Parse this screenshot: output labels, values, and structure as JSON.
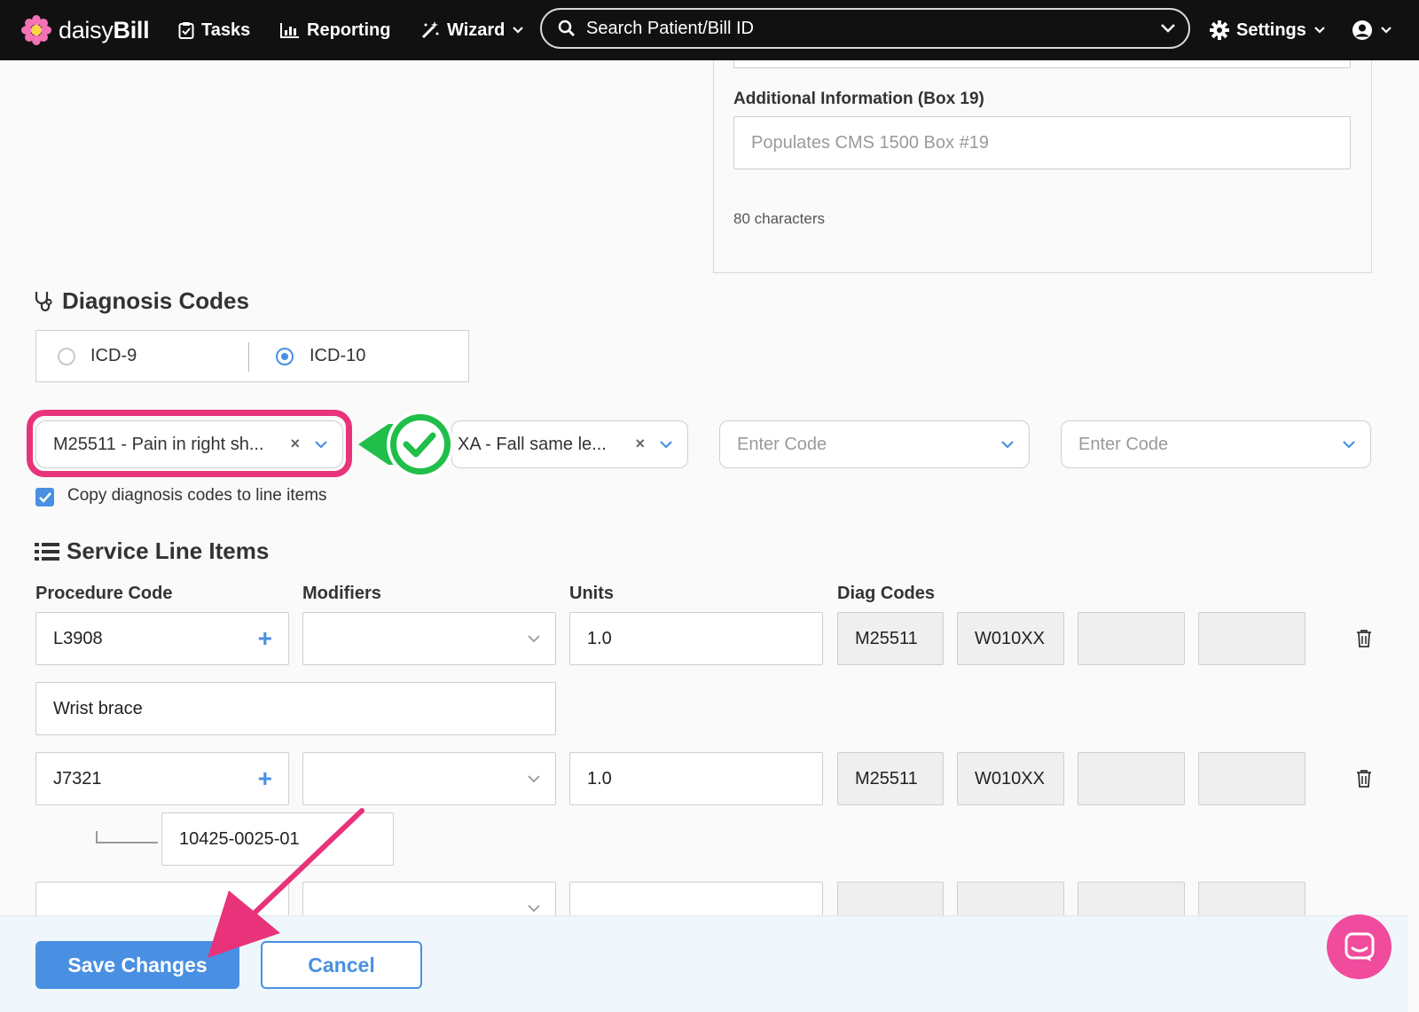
{
  "nav": {
    "logo_text_light": "daisy",
    "logo_text_bold": "Bill",
    "tasks_label": "Tasks",
    "reporting_label": "Reporting",
    "wizard_label": "Wizard",
    "search_placeholder": "Search Patient/Bill ID",
    "settings_label": "Settings"
  },
  "additional_info": {
    "label": "Additional Information (Box 19)",
    "placeholder": "Populates CMS 1500 Box #19",
    "char_count": "80 characters"
  },
  "diagnosis": {
    "title": "Diagnosis Codes",
    "icd9_label": "ICD-9",
    "icd10_label": "ICD-10",
    "selected_standard": "ICD-10",
    "code1": "M25511 - Pain in right sh...",
    "code2": "XA - Fall same le...",
    "code3_placeholder": "Enter Code",
    "code4_placeholder": "Enter Code",
    "copy_label": "Copy diagnosis codes to line items",
    "copy_checked": true
  },
  "service_lines": {
    "title": "Service Line Items",
    "headers": {
      "procedure": "Procedure Code",
      "modifiers": "Modifiers",
      "units": "Units",
      "diag": "Diag Codes"
    },
    "rows": [
      {
        "procedure": "L3908",
        "units": "1.0",
        "diag1": "M25511",
        "diag2": "W010XX",
        "description": "Wrist brace"
      },
      {
        "procedure": "J7321",
        "units": "1.0",
        "diag1": "M25511",
        "diag2": "W010XX",
        "ndc": "10425-0025-01"
      }
    ]
  },
  "footer": {
    "save_label": "Save Changes",
    "cancel_label": "Cancel"
  },
  "colors": {
    "accent": "#4a90e2",
    "highlight": "#e8337a",
    "success": "#1fbf4a",
    "navbar": "#111111"
  }
}
